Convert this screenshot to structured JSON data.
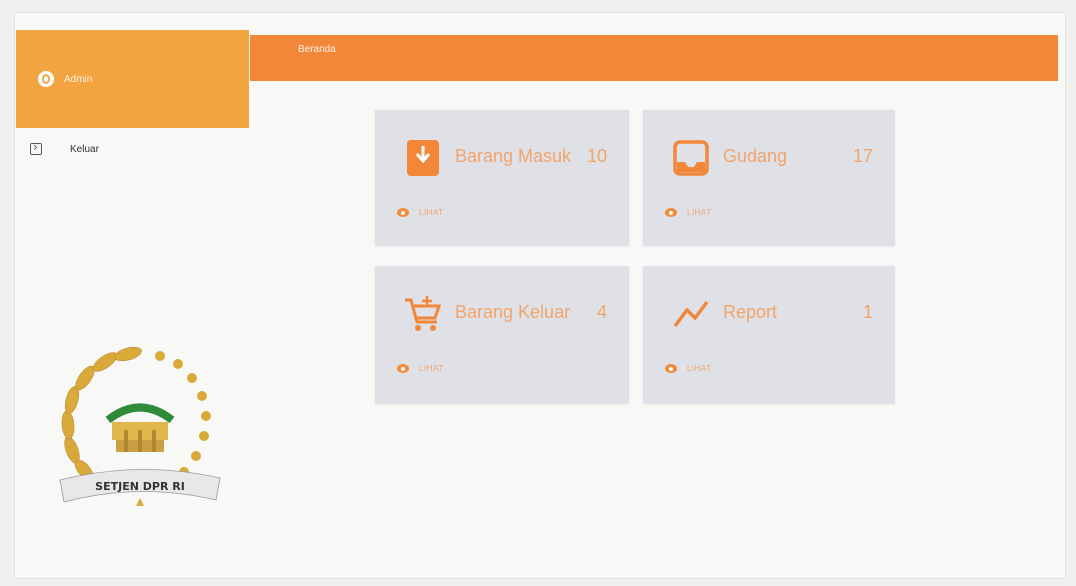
{
  "sidebar": {
    "user_name": "Admin",
    "menu": [
      {
        "label": "Keluar",
        "icon": "logout-icon"
      }
    ],
    "logo_text": "SETJEN DPR RI"
  },
  "topbar": {
    "title": "Beranda"
  },
  "cards": [
    {
      "title": "Barang Masuk",
      "count": "10",
      "icon": "inbox-download-icon",
      "link": "LIHAT"
    },
    {
      "title": "Gudang",
      "count": "17",
      "icon": "warehouse-tray-icon",
      "link": "LIHAT"
    },
    {
      "title": "Barang Keluar",
      "count": "4",
      "icon": "cart-add-icon",
      "link": "LIHAT"
    },
    {
      "title": "Report",
      "count": "1",
      "icon": "trend-icon",
      "link": "LIHAT"
    }
  ],
  "colors": {
    "sidebar_header": "#f2a441",
    "topbar": "#f2873a",
    "card_bg": "#dfe1e6",
    "accent": "#f2873a"
  }
}
